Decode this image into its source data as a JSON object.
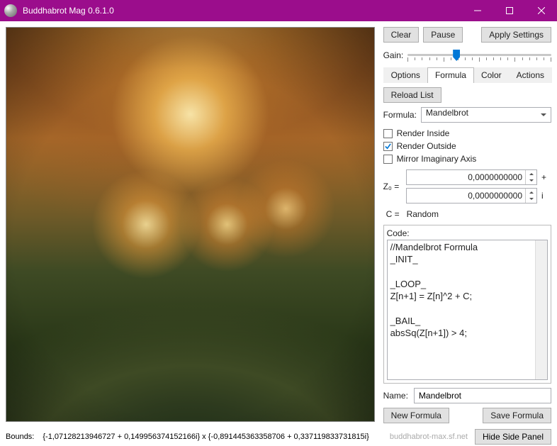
{
  "window": {
    "title": "Buddhabrot Mag 0.6.1.0"
  },
  "toolbar": {
    "clear": "Clear",
    "pause": "Pause",
    "apply": "Apply Settings"
  },
  "gain": {
    "label": "Gain:",
    "position_pct": 34
  },
  "tabs": {
    "options": "Options",
    "formula": "Formula",
    "color": "Color",
    "actions": "Actions",
    "active": "formula"
  },
  "formula_tab": {
    "reload_list": "Reload List",
    "formula_label": "Formula:",
    "formula_selected": "Mandelbrot",
    "render_inside": {
      "label": "Render Inside",
      "checked": false
    },
    "render_outside": {
      "label": "Render Outside",
      "checked": true
    },
    "mirror_imag": {
      "label": "Mirror Imaginary Axis",
      "checked": false
    },
    "z0_label": "Z₀ =",
    "z0_real": "0,0000000000",
    "z0_plus": "+",
    "z0_imag": "0,0000000000",
    "z0_i": "i",
    "c_label": "C =",
    "c_value": "Random",
    "code_label": "Code:",
    "code": "//Mandelbrot Formula\n_INIT_\n\n_LOOP_\nZ[n+1] = Z[n]^2 + C;\n\n_BAIL_\nabsSq(Z[n+1]) > 4;",
    "name_label": "Name:",
    "name_value": "Mandelbrot",
    "new_formula": "New Formula",
    "save_formula": "Save Formula"
  },
  "footer": {
    "bounds_label": "Bounds:",
    "bounds_value": "{-1,07128213946727 + 0,149956374152166i} x {-0,891445363358706 + 0,337119833731815i}",
    "url": "buddhabrot-max.sf.net",
    "hide_panel": "Hide Side Panel"
  }
}
